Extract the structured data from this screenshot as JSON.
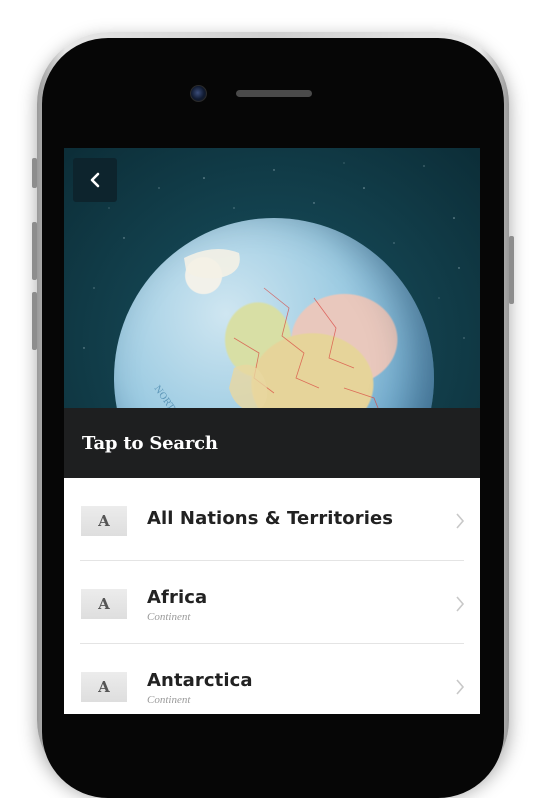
{
  "header": {
    "back_label": "Back"
  },
  "search": {
    "label": "Tap to Search"
  },
  "list": {
    "items": [
      {
        "badge": "A",
        "title": "All Nations & Territories",
        "subtitle": ""
      },
      {
        "badge": "A",
        "title": "Africa",
        "subtitle": "Continent"
      },
      {
        "badge": "A",
        "title": "Antarctica",
        "subtitle": "Continent"
      }
    ]
  },
  "colors": {
    "search_bar_bg": "#1e1f20",
    "back_button_bg": "#0d242d",
    "space_bg": "#13424f"
  },
  "icons": [
    "chevron-left-icon",
    "chevron-right-icon",
    "globe-image"
  ]
}
